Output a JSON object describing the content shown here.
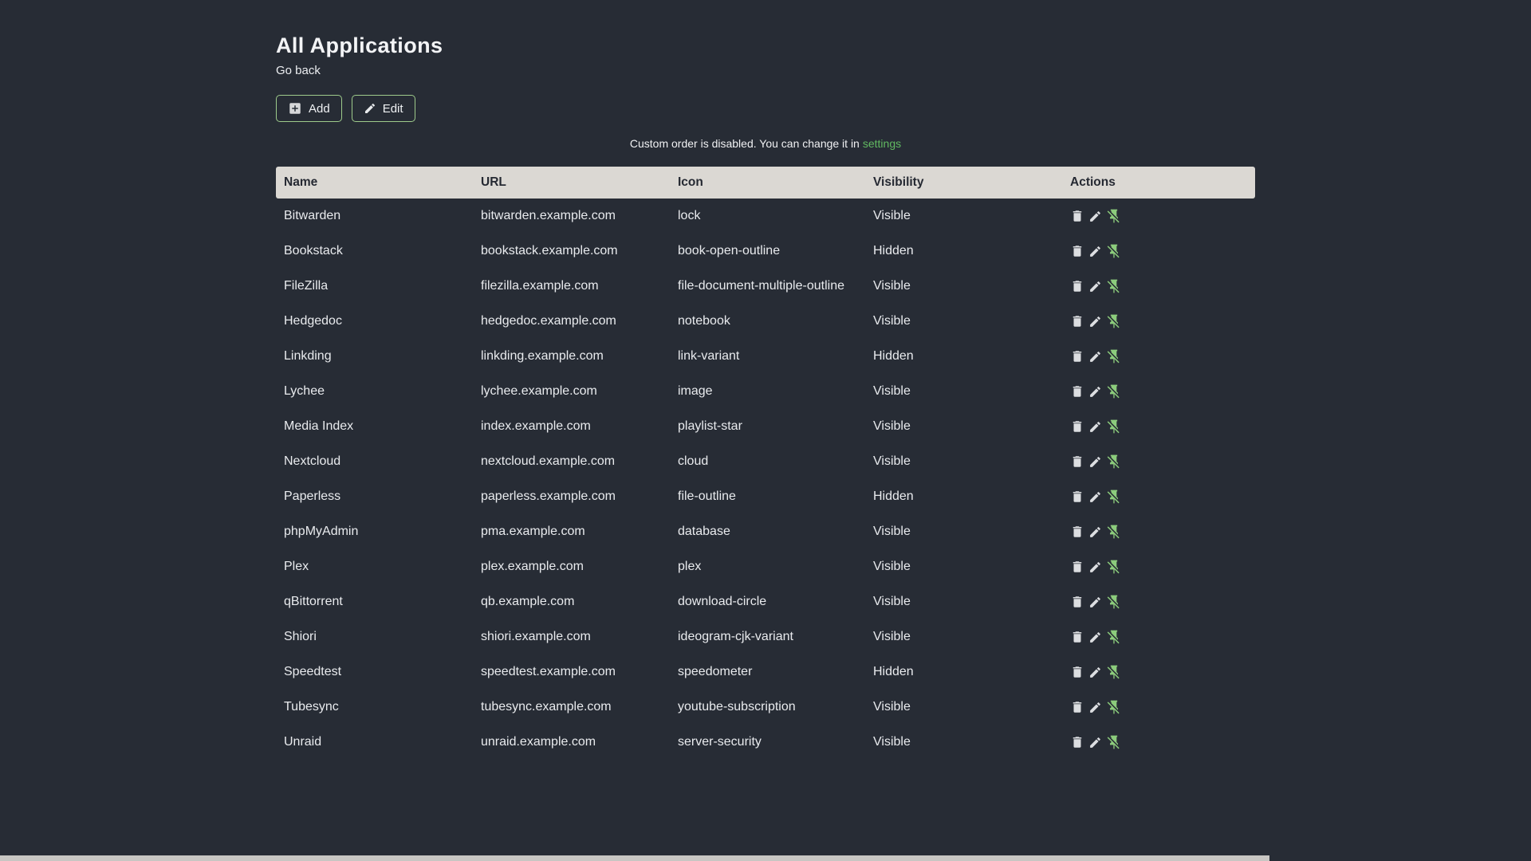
{
  "header": {
    "title": "All Applications",
    "back_link_label": "Go back"
  },
  "toolbar": {
    "add_label": "Add",
    "edit_label": "Edit"
  },
  "notice": {
    "text": "Custom order is disabled. You can change it in",
    "link_label": "settings"
  },
  "table": {
    "columns": [
      "Name",
      "URL",
      "Icon",
      "Visibility",
      "Actions"
    ],
    "row_actions": [
      "delete",
      "edit",
      "unpin"
    ],
    "rows": [
      {
        "name": "Bitwarden",
        "url": "bitwarden.example.com",
        "icon": "lock",
        "visibility": "Visible"
      },
      {
        "name": "Bookstack",
        "url": "bookstack.example.com",
        "icon": "book-open-outline",
        "visibility": "Hidden"
      },
      {
        "name": "FileZilla",
        "url": "filezilla.example.com",
        "icon": "file-document-multiple-outline",
        "visibility": "Visible"
      },
      {
        "name": "Hedgedoc",
        "url": "hedgedoc.example.com",
        "icon": "notebook",
        "visibility": "Visible"
      },
      {
        "name": "Linkding",
        "url": "linkding.example.com",
        "icon": "link-variant",
        "visibility": "Hidden"
      },
      {
        "name": "Lychee",
        "url": "lychee.example.com",
        "icon": "image",
        "visibility": "Visible"
      },
      {
        "name": "Media Index",
        "url": "index.example.com",
        "icon": "playlist-star",
        "visibility": "Visible"
      },
      {
        "name": "Nextcloud",
        "url": "nextcloud.example.com",
        "icon": "cloud",
        "visibility": "Visible"
      },
      {
        "name": "Paperless",
        "url": "paperless.example.com",
        "icon": "file-outline",
        "visibility": "Hidden"
      },
      {
        "name": "phpMyAdmin",
        "url": "pma.example.com",
        "icon": "database",
        "visibility": "Visible"
      },
      {
        "name": "Plex",
        "url": "plex.example.com",
        "icon": "plex",
        "visibility": "Visible"
      },
      {
        "name": "qBittorrent",
        "url": "qb.example.com",
        "icon": "download-circle",
        "visibility": "Visible"
      },
      {
        "name": "Shiori",
        "url": "shiori.example.com",
        "icon": "ideogram-cjk-variant",
        "visibility": "Visible"
      },
      {
        "name": "Speedtest",
        "url": "speedtest.example.com",
        "icon": "speedometer",
        "visibility": "Hidden"
      },
      {
        "name": "Tubesync",
        "url": "tubesync.example.com",
        "icon": "youtube-subscription",
        "visibility": "Visible"
      },
      {
        "name": "Unraid",
        "url": "unraid.example.com",
        "icon": "server-security",
        "visibility": "Visible"
      }
    ]
  },
  "colors": {
    "background": "#272c35",
    "text": "#eceef1",
    "accent_link_green": "#61b961",
    "button_border_green": "#9ecb8b",
    "pin_icon_green": "#8ccc7c",
    "table_header_bg": "#dbd8d3",
    "table_header_text": "#252932",
    "action_icon_gray": "#dcdee1",
    "scrollbar_thumb": "#c8c6c3"
  }
}
